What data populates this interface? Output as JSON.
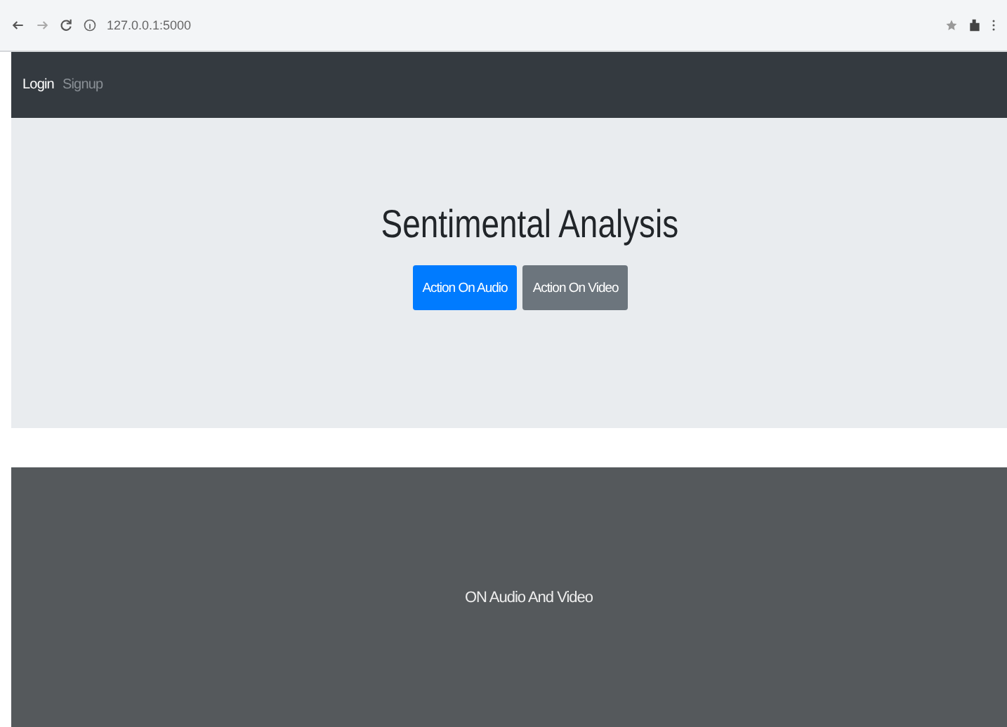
{
  "browser": {
    "address": "127.0.0.1:5000"
  },
  "navbar": {
    "links": [
      {
        "label": "Login",
        "selected": true
      },
      {
        "label": "Signup",
        "selected": false
      }
    ]
  },
  "hero": {
    "title": "Sentimental Analysis",
    "buttons": [
      {
        "label": "Action On Audio",
        "kind": "primary"
      },
      {
        "label": "Action On Video",
        "kind": "secondary"
      }
    ]
  },
  "footer": {
    "text": "ON Audio And Video"
  }
}
